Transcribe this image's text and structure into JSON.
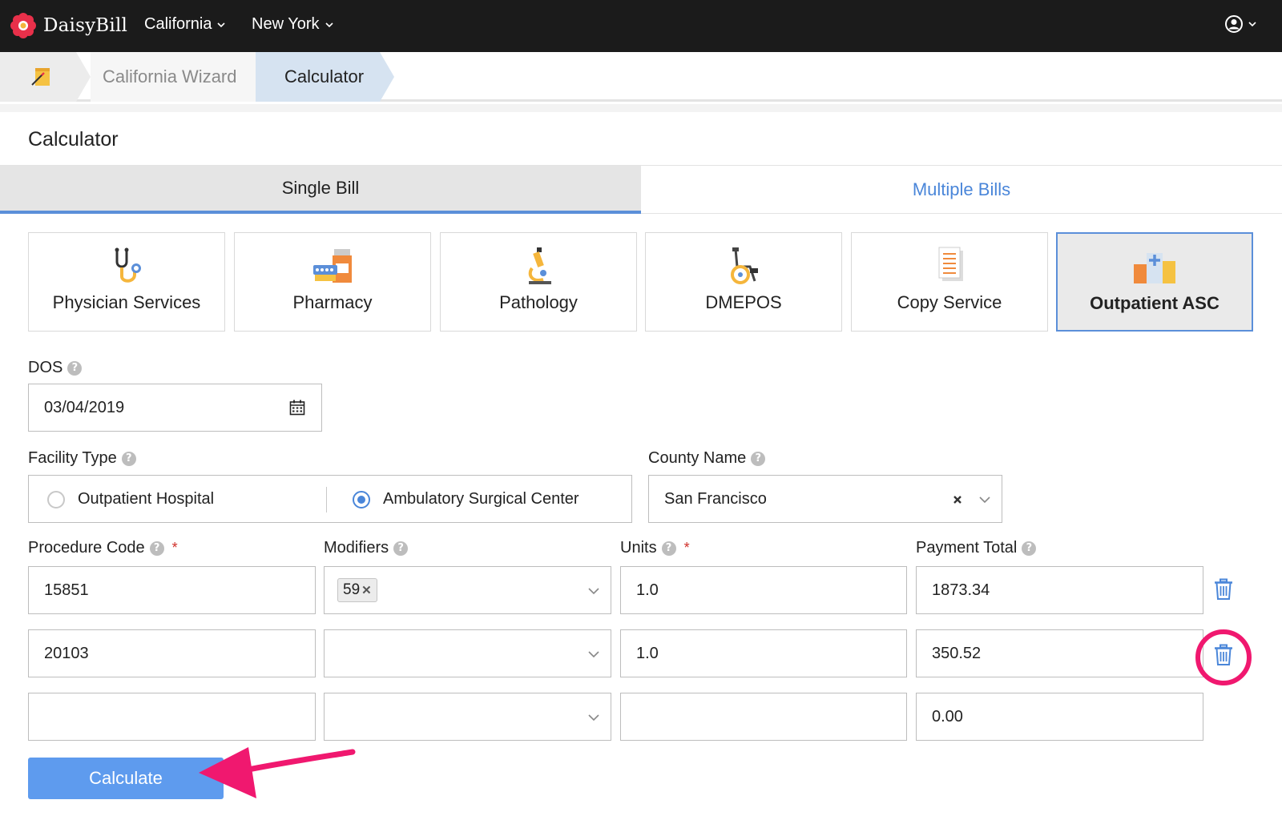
{
  "nav": {
    "brand": "DaisyBill",
    "menus": [
      {
        "label": "California"
      },
      {
        "label": "New York"
      }
    ]
  },
  "breadcrumb": {
    "items": [
      "California Wizard",
      "Calculator"
    ]
  },
  "page": {
    "title": "Calculator"
  },
  "tabs": [
    {
      "label": "Single Bill",
      "active": true
    },
    {
      "label": "Multiple Bills",
      "active": false
    }
  ],
  "categories": [
    {
      "label": "Physician Services",
      "icon": "stethoscope-icon"
    },
    {
      "label": "Pharmacy",
      "icon": "pharmacy-icon"
    },
    {
      "label": "Pathology",
      "icon": "microscope-icon"
    },
    {
      "label": "DMEPOS",
      "icon": "wheelchair-icon"
    },
    {
      "label": "Copy Service",
      "icon": "document-copy-icon"
    },
    {
      "label": "Outpatient ASC",
      "icon": "hospital-building-icon",
      "selected": true
    }
  ],
  "form": {
    "dos": {
      "label": "DOS",
      "value": "03/04/2019"
    },
    "facility_type": {
      "label": "Facility Type",
      "options": [
        "Outpatient Hospital",
        "Ambulatory Surgical Center"
      ],
      "selected": "Ambulatory Surgical Center"
    },
    "county": {
      "label": "County Name",
      "value": "San Francisco"
    },
    "columns": {
      "procedure_code": "Procedure Code",
      "modifiers": "Modifiers",
      "units": "Units",
      "payment_total": "Payment Total",
      "required_mark": "*"
    },
    "rows": [
      {
        "procedure_code": "15851",
        "modifier_tag": "59",
        "units": "1.0",
        "payment_total": "1873.34"
      },
      {
        "procedure_code": "20103",
        "modifier_tag": "",
        "units": "1.0",
        "payment_total": "350.52"
      },
      {
        "procedure_code": "",
        "modifier_tag": "",
        "units": "",
        "payment_total": "0.00"
      }
    ],
    "calculate_label": "Calculate"
  },
  "colors": {
    "accent": "#5b8fd9",
    "annotation": "#f0186f",
    "nav_bg": "#1b1b1b"
  }
}
